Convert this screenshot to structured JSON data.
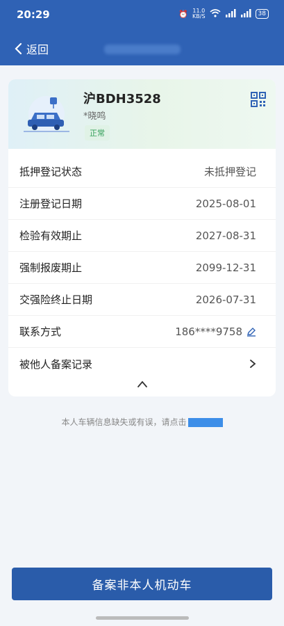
{
  "status_bar": {
    "time": "20:29",
    "speed": "11.0\nKB/S",
    "battery": "38"
  },
  "nav": {
    "back_label": "返回"
  },
  "vehicle": {
    "plate": "沪BDH3528",
    "owner": "*晓鸣",
    "status": "正常"
  },
  "details": [
    {
      "label": "抵押登记状态",
      "value": "未抵押登记"
    },
    {
      "label": "注册登记日期",
      "value": "2025-08-01"
    },
    {
      "label": "检验有效期止",
      "value": "2027-08-31"
    },
    {
      "label": "强制报废期止",
      "value": "2099-12-31"
    },
    {
      "label": "交强险终止日期",
      "value": "2026-07-31"
    },
    {
      "label": "联系方式",
      "value": "186****9758"
    }
  ],
  "filed_by_others": {
    "label": "被他人备案记录"
  },
  "hint": {
    "text": "本人车辆信息缺失或有误，请点击"
  },
  "primary_button": {
    "label": "备案非本人机动车"
  },
  "colors": {
    "header": "#2f62b5",
    "button": "#2a5caa",
    "badge": "#35a05a"
  }
}
